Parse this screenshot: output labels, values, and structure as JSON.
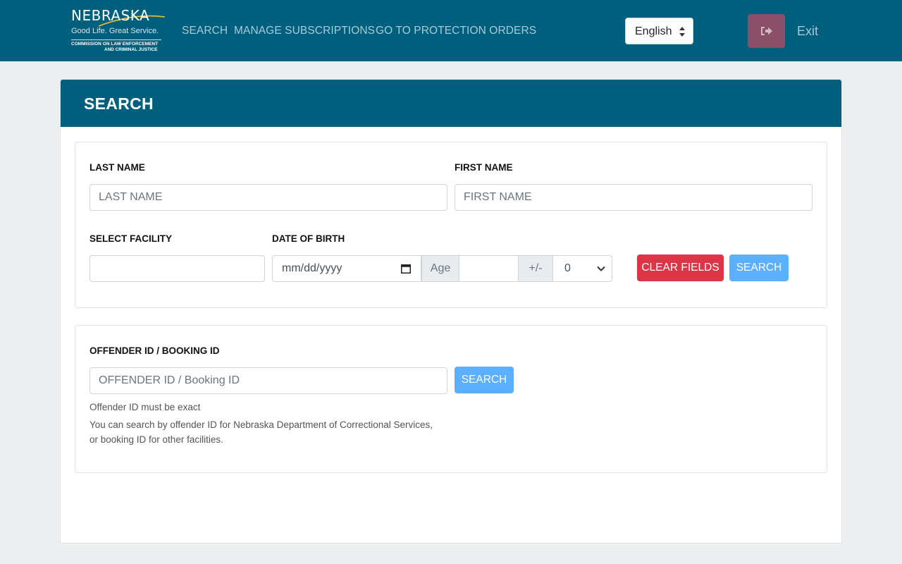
{
  "navbar": {
    "logo": {
      "state": "NEBRASKA",
      "tagline": "Good Life. Great Service.",
      "commission_line1": "COMMISSION ON LAW ENFORCEMENT",
      "commission_line2": "AND CRIMINAL JUSTICE"
    },
    "links": {
      "search": "SEARCH",
      "subscriptions": "MANAGE SUBSCRIPTIONS",
      "protection_orders": "GO TO PROTECTION ORDERS"
    },
    "language": "English",
    "exit_label": "Exit"
  },
  "search_card": {
    "title": "SEARCH",
    "name_panel": {
      "last_name_label": "LAST NAME",
      "last_name_placeholder": "LAST NAME",
      "first_name_label": "FIRST NAME",
      "first_name_placeholder": "FIRST NAME",
      "facility_label": "SELECT FACILITY",
      "dob_label": "DATE OF BIRTH",
      "dob_placeholder": "mm/dd/yyyy",
      "age_addon": "Age",
      "plus_minus_addon": "+/-",
      "plus_minus_value": "0",
      "clear_button": "CLEAR FIELDS",
      "search_button": "SEARCH"
    },
    "id_panel": {
      "label": "OFFENDER ID / BOOKING ID",
      "placeholder": "OFFENDER ID / Booking ID",
      "search_button": "SEARCH",
      "help_exact": "Offender ID must be exact",
      "help_line1": "You can search by offender ID for Nebraska Department of Correctional Services,",
      "help_line2": "or booking ID for other facilities."
    }
  },
  "colors": {
    "brand": "#005f7d",
    "danger": "#dc3545",
    "primary_light": "#5aafff",
    "exit": "#8b4f68"
  }
}
